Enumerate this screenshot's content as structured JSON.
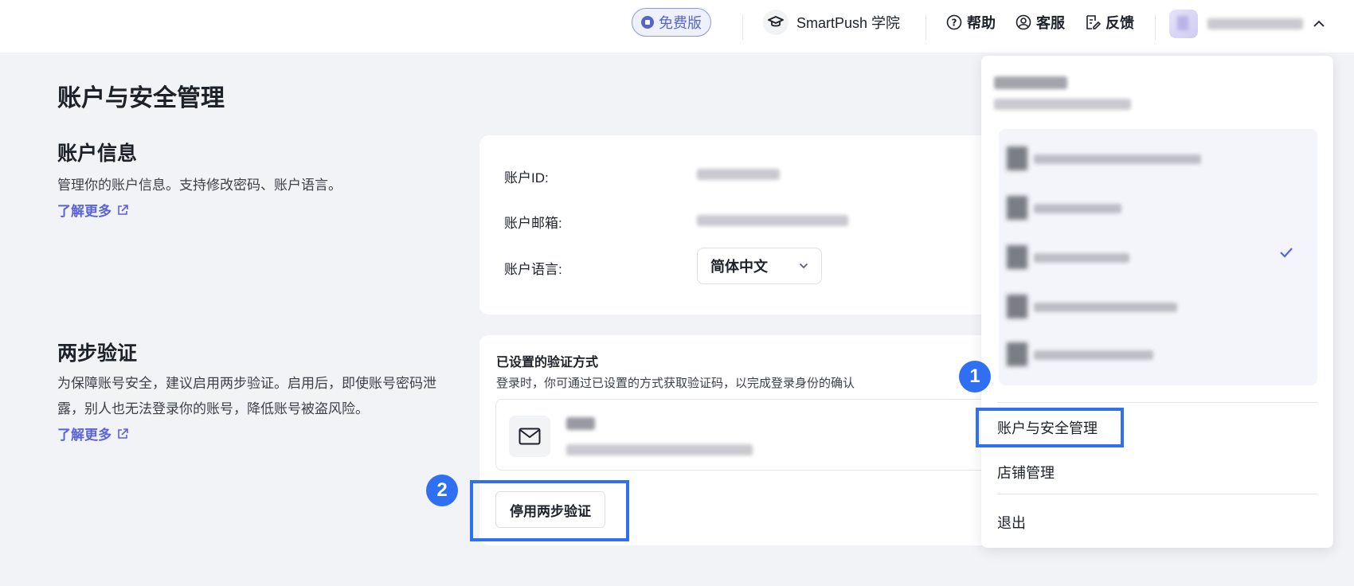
{
  "topbar": {
    "plan_badge": "免费版",
    "academy": "SmartPush 学院",
    "help": "帮助",
    "support": "客服",
    "feedback": "反馈"
  },
  "page": {
    "title": "账户与安全管理"
  },
  "account_info": {
    "title": "账户信息",
    "desc": "管理你的账户信息。支持修改密码、账户语言。",
    "learn_more": "了解更多",
    "id_label": "账户ID:",
    "email_label": "账户邮箱:",
    "language_label": "账户语言:",
    "language_value": "简体中文"
  },
  "two_step": {
    "title": "两步验证",
    "desc": "为保障账号安全，建议启用两步验证。启用后，即使账号密码泄露，别人也无法登录你的账号，降低账号被盗风险。",
    "learn_more": "了解更多",
    "configured_title": "已设置的验证方式",
    "configured_desc": "登录时，你可通过已设置的方式获取验证码，以完成登录身份的确认",
    "disable_button": "停用两步验证"
  },
  "dropdown": {
    "menu": {
      "account_security": "账户与安全管理",
      "store_management": "店铺管理",
      "logout": "退出"
    }
  },
  "annotations": {
    "step1": "1",
    "step2": "2"
  },
  "colors": {
    "accent": "#5a63d8",
    "highlight": "#2f6ff2"
  }
}
